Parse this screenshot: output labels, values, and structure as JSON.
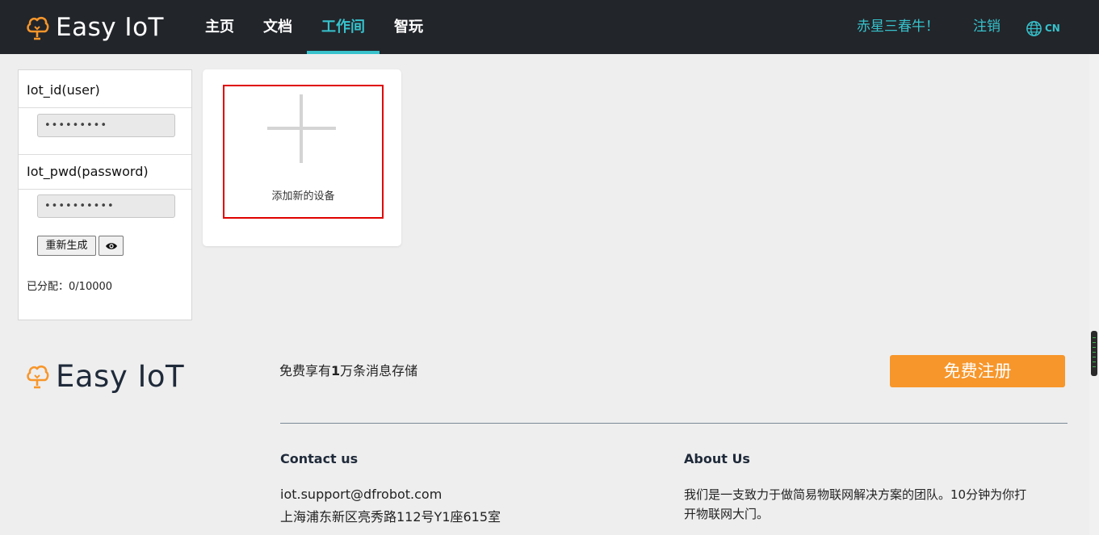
{
  "brand": {
    "name": "Easy IoT",
    "icon": "cloud-bulb-icon",
    "color": "#f7962a"
  },
  "nav": {
    "items": [
      {
        "label": "主页",
        "active": false
      },
      {
        "label": "文档",
        "active": false
      },
      {
        "label": "工作间",
        "active": true
      },
      {
        "label": "智玩",
        "active": false
      }
    ],
    "user": "赤星三春牛！",
    "logout": "注销",
    "language": "CN",
    "accent": "#37c2cc"
  },
  "credentials": {
    "iot_id_label": "Iot_id(user)",
    "iot_id_value": "•••••••••",
    "iot_pwd_label": "Iot_pwd(password)",
    "iot_pwd_value": "••••••••••",
    "regenerate_label": "重新生成",
    "toggle_icon": "eye-icon",
    "allocated_label": "已分配：",
    "allocated_value": "0/10000"
  },
  "device": {
    "add_label": "添加新的设备",
    "highlight_color": "#e00000"
  },
  "footer": {
    "brand": "Easy IoT",
    "promo_prefix": "免费享有",
    "promo_strong": "1",
    "promo_suffix": "万条消息存储",
    "signup": "免费注册",
    "contact_title": "Contact us",
    "contact_email": "iot.support@dfrobot.com",
    "contact_address": "上海浦东新区亮秀路112号Y1座615室",
    "about_title": "About Us",
    "about_text_1": "我们是一支致力于做简易物联网解决方案的团队。10分钟为你打",
    "about_text_2": "开物联网大门。"
  }
}
